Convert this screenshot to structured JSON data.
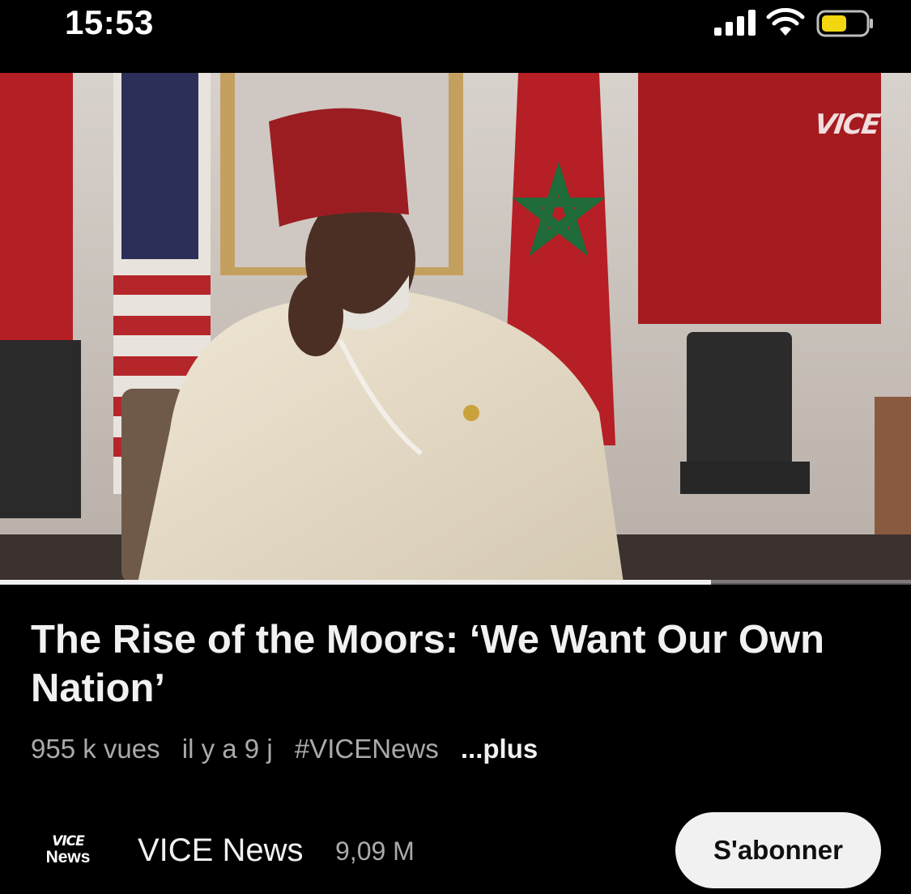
{
  "status_bar": {
    "time": "15:53",
    "icons": [
      "signal-icon",
      "wifi-icon",
      "battery-icon"
    ],
    "battery_color": "#f2d60f"
  },
  "video": {
    "watermark": "VICE",
    "progress": 0.78
  },
  "title": "The Rise of the Moors: ‘We Want Our Own Nation’",
  "meta": {
    "views": "955 k vues",
    "age": "il y a 9 j",
    "hashtag": "#VICENews",
    "more": "...plus"
  },
  "channel": {
    "avatar_top": "VICE",
    "avatar_bottom": "News",
    "name": "VICE News",
    "subscribers": "9,09 M",
    "subscribe_label": "S'abonner"
  },
  "colors": {
    "background": "#000000",
    "title": "#f1f1f1",
    "secondary_text": "#aaaaaa",
    "subscribe_bg": "#f1f1f1"
  }
}
